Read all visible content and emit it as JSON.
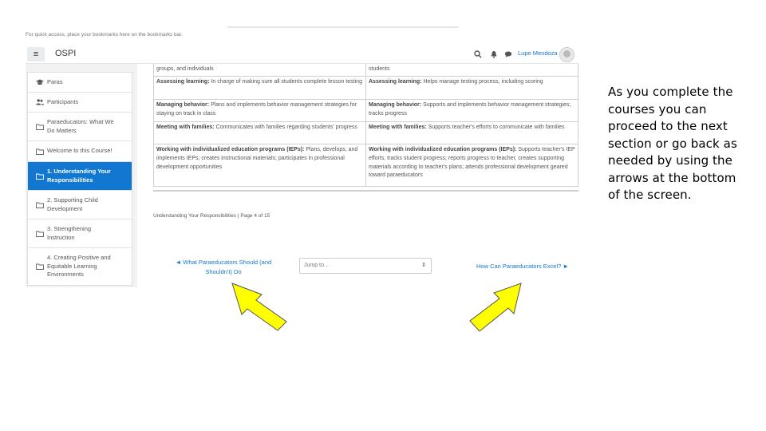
{
  "browser": {
    "bookmark_hint": "For quick access, place your bookmarks here on the bookmarks bar."
  },
  "header": {
    "brand": "OSPI",
    "username": "Lupe Mendoza",
    "icons": [
      "menu-icon",
      "search-icon",
      "bell-icon",
      "chat-icon",
      "user-avatar"
    ]
  },
  "sidebar": {
    "items": [
      {
        "label": "Paras",
        "icon": "graduation-cap-icon",
        "active": false
      },
      {
        "label": "Participants",
        "icon": "users-icon",
        "active": false
      },
      {
        "label_lines": [
          "Paraeducators: What We",
          "Do Matters"
        ],
        "icon": "folder-icon",
        "active": false
      },
      {
        "label": "Welcome to this Course!",
        "icon": "folder-icon",
        "active": false
      },
      {
        "label_lines": [
          "1. Understanding Your",
          "Responsibilities"
        ],
        "icon": "folder-icon",
        "active": true
      },
      {
        "label_lines": [
          "2. Supporting Child",
          "Development"
        ],
        "icon": "folder-icon",
        "active": false
      },
      {
        "label_lines": [
          "3. Strengthening",
          "Instruction"
        ],
        "icon": "folder-icon",
        "active": false
      },
      {
        "label_lines": [
          "4. Creating Positive and",
          "Equitable Learning",
          "Environments"
        ],
        "icon": "folder-icon",
        "active": false
      }
    ]
  },
  "table": {
    "rows": [
      {
        "left": "groups, and individuals",
        "right": "students"
      },
      {
        "left_label": "Assessing learning:",
        "left": " In charge of making sure all students complete lesson testing",
        "right_label": "Assessing learning:",
        "right": " Helps manage testing process, including scoring"
      },
      {
        "left_label": "Managing behavior:",
        "left": " Plans and implements behavior management strategies for staying on track in class",
        "right_label": "Managing behavior:",
        "right": " Supports and implements behavior management strategies; tracks progress"
      },
      {
        "left_label": "Meeting with families:",
        "left": " Communicates with families regarding students' progress",
        "right_label": "Meeting with families:",
        "right": " Supports teacher's efforts to communicate with families"
      },
      {
        "left_label": "Working with individualized education programs (IEPs):",
        "left": " Plans, develops, and implements IEPs; creates instructional materials; participates in professional development opportunities",
        "right_label": "Working with individualized education programs (IEPs):",
        "right": " Supports teacher's IEP efforts, tracks student progress; reports progress to teacher, creates supporting materials according to teacher's plans; attends professional development geared toward paraeducators"
      }
    ]
  },
  "pager": {
    "text": "Understanding Your Responsibilities | Page 4 of 15"
  },
  "navigation": {
    "prev_lines": [
      "◄ What Paraeducators Should (and",
      "Shouldn't) Do"
    ],
    "jump_placeholder": "Jump to...",
    "next": "How Can Paraeducators Excel? ►"
  },
  "annotation": {
    "caption_lines": [
      "As you complete the",
      "courses you can",
      "proceed to the next",
      "section or go back as",
      "needed by using the",
      "arrows at the bottom",
      "of the screen."
    ],
    "arrow_color": "#ffff00"
  },
  "colors": {
    "accent": "#1177d1",
    "highlight_arrow": "#ffff00"
  }
}
